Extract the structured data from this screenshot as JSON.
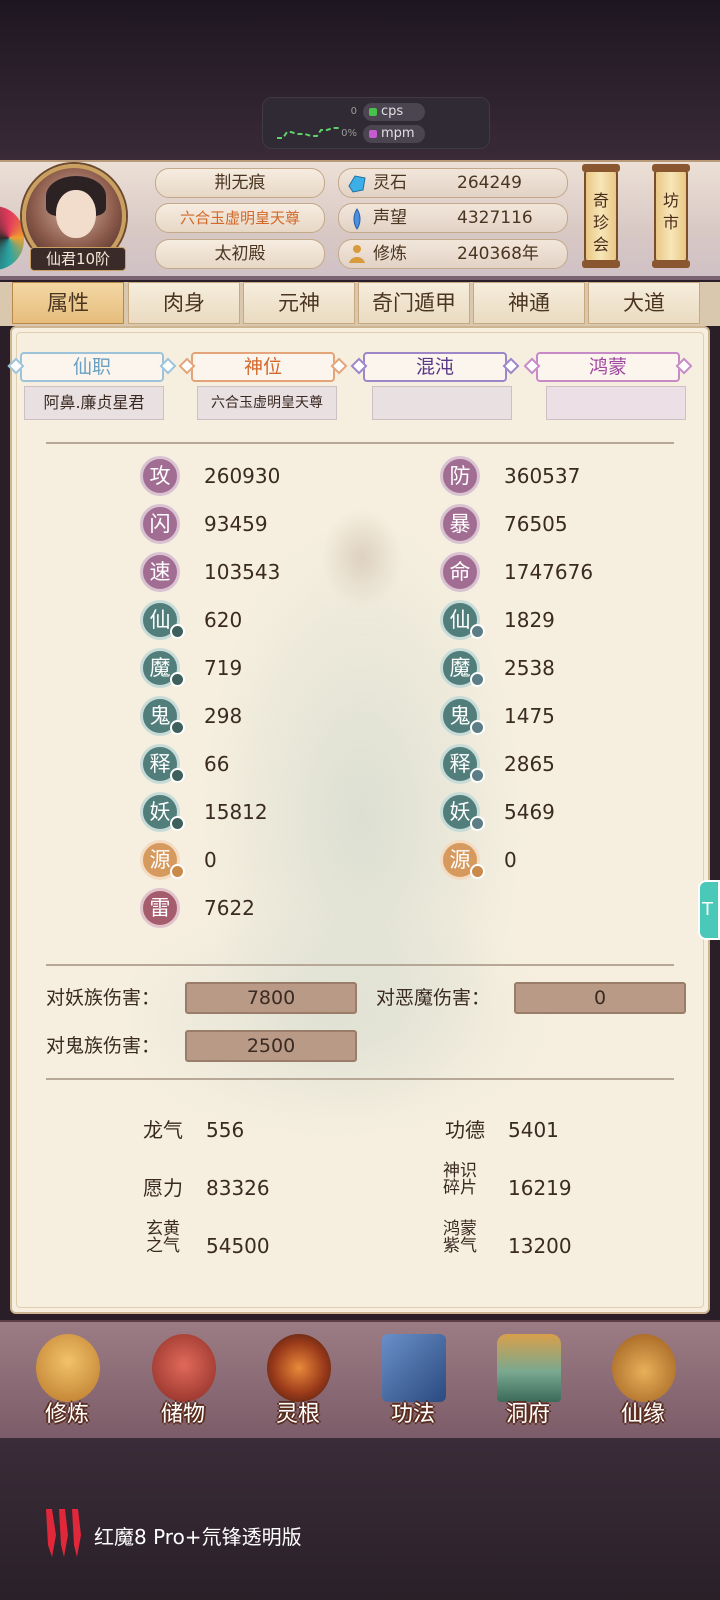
{
  "perf": {
    "cps_label": "cps",
    "mpm_label": "mpm",
    "cps_value": "0",
    "mpm_value": "0%"
  },
  "header": {
    "rank": "仙君10阶",
    "name": "荆无痕",
    "title": "六合玉虚明皇天尊",
    "hall": "太初殿",
    "stats": [
      {
        "label": "灵石",
        "value": "264249",
        "icon": "spirit-stone-icon"
      },
      {
        "label": "声望",
        "value": "4327116",
        "icon": "prestige-icon"
      },
      {
        "label": "修炼",
        "value": "240368年",
        "icon": "meditation-icon"
      }
    ],
    "scroll_left": "奇珍会",
    "scroll_right": "坊市"
  },
  "tabs": [
    "属性",
    "肉身",
    "元神",
    "奇门遁甲",
    "神通",
    "大道"
  ],
  "rank_tabs": [
    {
      "label": "仙职",
      "sub": "阿鼻.廉贞星君",
      "color": "#6aa0c2"
    },
    {
      "label": "神位",
      "sub": "六合玉虚明皇天尊",
      "color": "#d2682a"
    },
    {
      "label": "混沌",
      "sub": "",
      "color": "#7a5aa8"
    },
    {
      "label": "鸿蒙",
      "sub": "",
      "color": "#a048a0"
    }
  ],
  "attrs_left": [
    {
      "k": "攻",
      "v": "260930",
      "style": "purple",
      "badge": false
    },
    {
      "k": "闪",
      "v": "93459",
      "style": "purple",
      "badge": false
    },
    {
      "k": "速",
      "v": "103543",
      "style": "purple",
      "badge": false
    },
    {
      "k": "仙",
      "v": "620",
      "style": "teal",
      "badge": true
    },
    {
      "k": "魔",
      "v": "719",
      "style": "teal",
      "badge": true
    },
    {
      "k": "鬼",
      "v": "298",
      "style": "teal",
      "badge": true
    },
    {
      "k": "释",
      "v": "66",
      "style": "teal",
      "badge": true
    },
    {
      "k": "妖",
      "v": "15812",
      "style": "teal",
      "badge": true
    },
    {
      "k": "源",
      "v": "0",
      "style": "orange",
      "badge": true
    },
    {
      "k": "雷",
      "v": "7622",
      "style": "red",
      "badge": false
    }
  ],
  "attrs_right": [
    {
      "k": "防",
      "v": "360537",
      "style": "purple",
      "badge": false
    },
    {
      "k": "暴",
      "v": "76505",
      "style": "purple",
      "badge": false
    },
    {
      "k": "命",
      "v": "1747676",
      "style": "purple",
      "badge": false
    },
    {
      "k": "仙",
      "v": "1829",
      "style": "teal",
      "badge": true
    },
    {
      "k": "魔",
      "v": "2538",
      "style": "teal",
      "badge": true
    },
    {
      "k": "鬼",
      "v": "1475",
      "style": "teal",
      "badge": true
    },
    {
      "k": "释",
      "v": "2865",
      "style": "teal",
      "badge": true
    },
    {
      "k": "妖",
      "v": "5469",
      "style": "teal",
      "badge": true
    },
    {
      "k": "源",
      "v": "0",
      "style": "orange",
      "badge": true
    }
  ],
  "damage": {
    "yao_label": "对妖族伤害：",
    "yao_value": "7800",
    "demon_label": "对恶魔伤害：",
    "demon_value": "0",
    "ghost_label": "对鬼族伤害：",
    "ghost_value": "2500"
  },
  "resources": {
    "left": [
      {
        "k": "龙气",
        "v": "556"
      },
      {
        "k": "愿力",
        "v": "83326"
      },
      {
        "k": "玄黄之气",
        "v": "54500"
      }
    ],
    "right": [
      {
        "k": "功德",
        "v": "5401"
      },
      {
        "k": "神识碎片",
        "v": "16219"
      },
      {
        "k": "鸿蒙紫气",
        "v": "13200"
      }
    ]
  },
  "nav": [
    {
      "label": "修炼",
      "icon": "cultivate-icon",
      "color": "#d9973a"
    },
    {
      "label": "储物",
      "icon": "storage-bag-icon",
      "color": "#c0443a"
    },
    {
      "label": "灵根",
      "icon": "spirit-root-icon",
      "color": "#c2572c"
    },
    {
      "label": "功法",
      "icon": "technique-book-icon",
      "color": "#4a6fa8"
    },
    {
      "label": "洞府",
      "icon": "cave-mansion-icon",
      "color": "#5a8a6a"
    },
    {
      "label": "仙缘",
      "icon": "fate-gourd-icon",
      "color": "#c98a3a"
    }
  ],
  "brand": {
    "text": "红魔8 Pro+氘锋透明版"
  }
}
